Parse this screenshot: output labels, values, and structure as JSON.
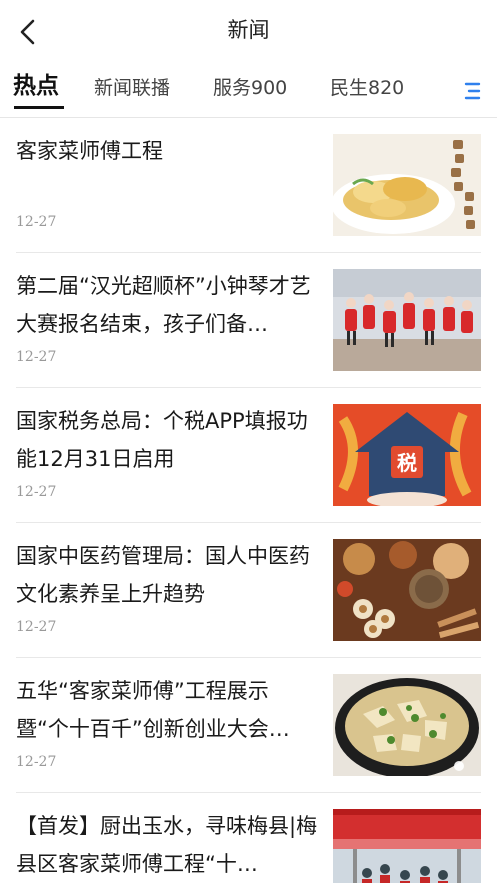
{
  "header": {
    "title": "新闻",
    "back_icon": "chevron-left-icon"
  },
  "tabs": [
    {
      "label": "热点",
      "active": true
    },
    {
      "label": "新闻联播",
      "active": false
    },
    {
      "label": "服务900",
      "active": false
    },
    {
      "label": "民生820",
      "active": false
    }
  ],
  "tabs_menu_icon": "menu-lines-icon",
  "accent_color": "#2f80ed",
  "news": [
    {
      "title": "客家菜师傅工程",
      "date": "12-27",
      "thumb": "steamed-chicken-dish"
    },
    {
      "title": "第二届“汉光超顺杯”小钟琴才艺大赛报名结束，孩子们备…",
      "date": "12-27",
      "thumb": "children-performing"
    },
    {
      "title": "国家税务总局：个税APP填报功能12月31日启用",
      "date": "12-27",
      "thumb_text": "税",
      "thumb": "tax-house-graphic"
    },
    {
      "title": "国家中医药管理局：国人中医药文化素养呈上升趋势",
      "date": "12-27",
      "thumb": "chinese-herbs"
    },
    {
      "title": "五华“客家菜师傅”工程展示暨“个十百千”创新创业大会…",
      "date": "12-27",
      "thumb": "hakka-dish-pot"
    },
    {
      "title": "【首发】厨出玉水，寻味梅县|梅县区客家菜师傅工程“十…",
      "date": "",
      "thumb": "outdoor-event"
    }
  ]
}
